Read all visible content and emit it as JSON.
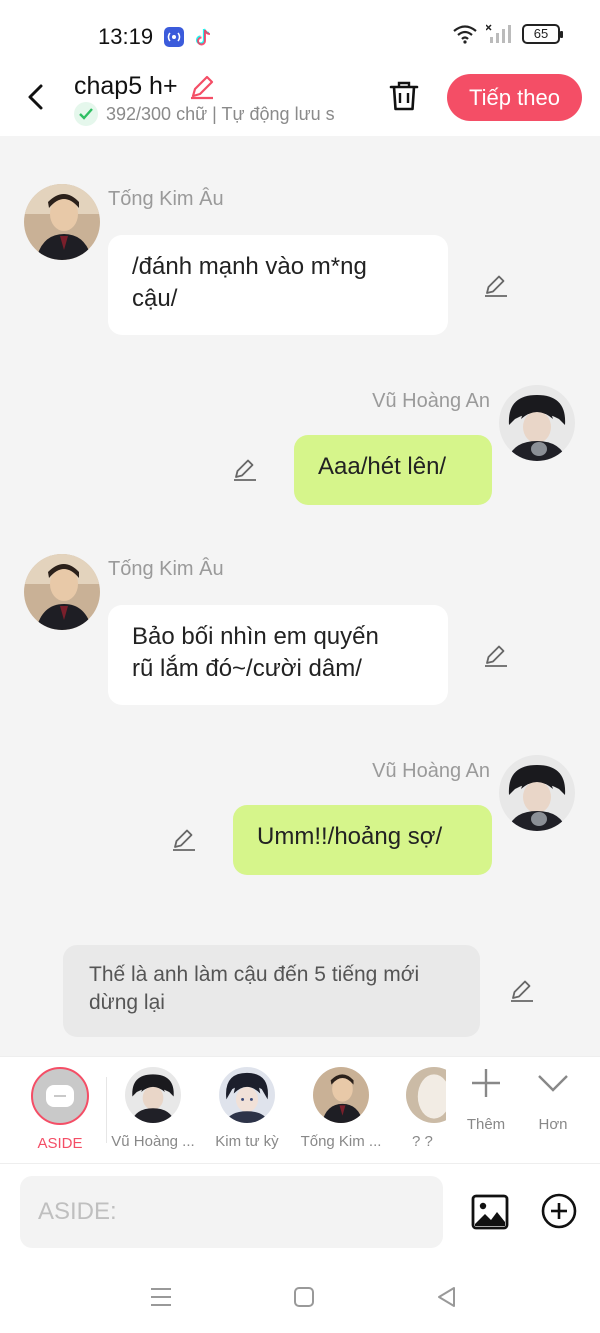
{
  "status_bar": {
    "time": "13:19",
    "battery": "65",
    "icons": [
      "nfc-icon",
      "tiktok-icon",
      "wifi-icon",
      "cellular-icon",
      "battery-icon"
    ]
  },
  "header": {
    "title": "chap5 h+",
    "subtitle": "392/300 chữ | Tự động lưu s",
    "next_label": "Tiếp theo"
  },
  "messages": [
    {
      "sender": "Tống Kim Âu",
      "side": "left",
      "line1": "/đánh mạnh vào m*ng",
      "line2": "cậu/"
    },
    {
      "sender": "Vũ Hoàng An",
      "side": "right",
      "line1": "Aaa/hét lên/"
    },
    {
      "sender": "Tống Kim Âu",
      "side": "left",
      "line1": "Bảo bối nhìn em quyến",
      "line2": "rũ lắm đó~/cười dâm/"
    },
    {
      "sender": "Vũ Hoàng An",
      "side": "right",
      "line1": "Umm!!/hoảng sợ/"
    },
    {
      "sender": "",
      "side": "aside",
      "line1": "Thế là anh làm cậu đến 5 tiếng mới",
      "line2": "dừng lại"
    }
  ],
  "characters": [
    {
      "label": "ASIDE"
    },
    {
      "label": "Vũ Hoàng ..."
    },
    {
      "label": "Kim tư kỳ"
    },
    {
      "label": "Tống Kim ..."
    },
    {
      "label": "? ?"
    }
  ],
  "char_actions": {
    "add_label": "Thêm",
    "more_label": "Hơn"
  },
  "input": {
    "placeholder": "ASIDE:"
  },
  "colors": {
    "accent": "#f44e66",
    "green_bubble": "#d6f58b",
    "background": "#f4f4f4"
  }
}
